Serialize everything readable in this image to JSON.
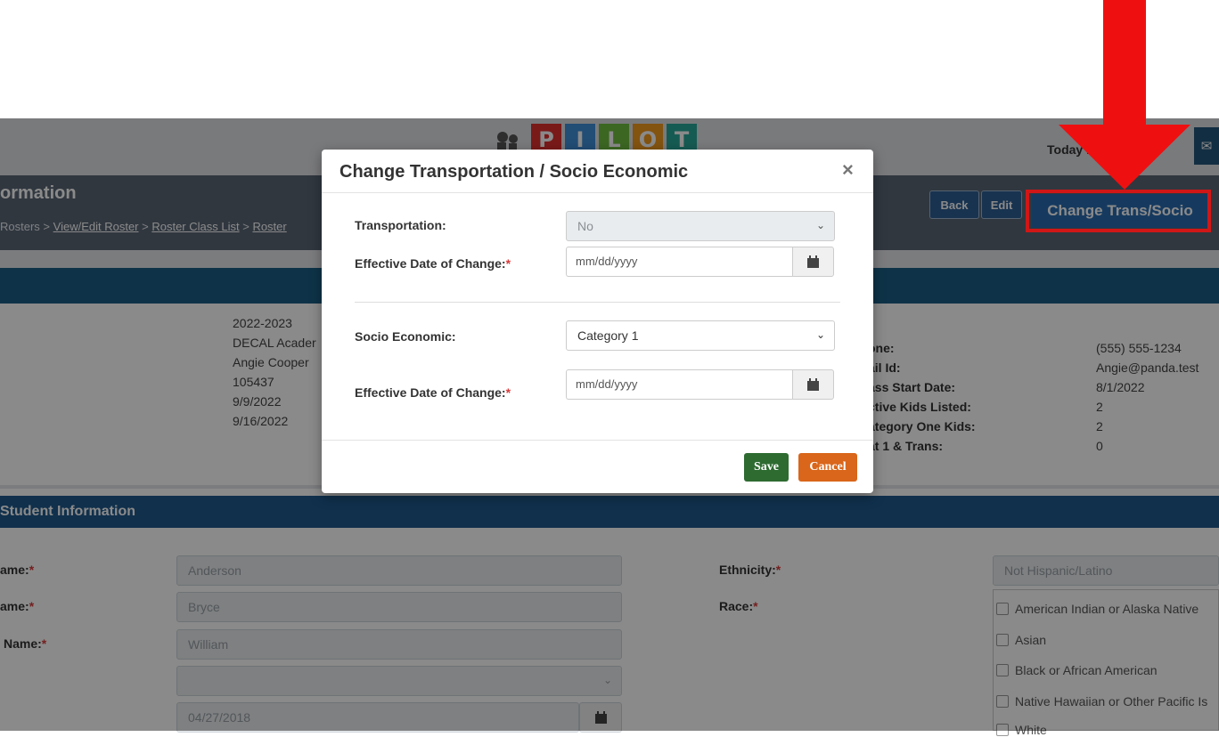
{
  "header": {
    "logo_letters": [
      "P",
      "I",
      "L",
      "O",
      "T"
    ],
    "logo_colors": [
      "#e0312f",
      "#3f8fd8",
      "#6fbf3f",
      "#f39a1e",
      "#2aa89a"
    ],
    "today_text": "Today is 9/9/2022"
  },
  "page": {
    "title": "ormation",
    "breadcrumb": [
      "Rosters",
      "View/Edit Roster",
      "Roster Class List",
      "Roster"
    ],
    "breadcrumb_sep": ">",
    "buttons": {
      "back": "Back",
      "edit": "Edit",
      "change": "Change Trans/Socio"
    }
  },
  "roster_info": {
    "left_values": [
      "2022-2023",
      "DECAL Acader",
      "Angie Cooper",
      "105437",
      "9/9/2022",
      "9/16/2022"
    ],
    "right_labels": [
      "one:",
      "ail Id:",
      "ass Start Date:",
      "ctive Kids Listed:",
      "ategory One Kids:",
      "at 1 & Trans:"
    ],
    "right_values": [
      "(555) 555-1234",
      "Angie@panda.test",
      "8/1/2022",
      "2",
      "2",
      "0"
    ]
  },
  "student": {
    "section_title": "Student Information",
    "fields": [
      {
        "label": "ame:",
        "value": "Anderson"
      },
      {
        "label": "ame:",
        "value": "Bryce"
      },
      {
        "label": "Name:",
        "value": "William"
      },
      {
        "label": "",
        "value": ""
      },
      {
        "label": "",
        "value": "04/27/2018"
      }
    ],
    "ethnicity_label": "Ethnicity:",
    "ethnicity_value": "Not Hispanic/Latino",
    "race_label": "Race:",
    "race_options": [
      "American Indian or Alaska Native",
      "Asian",
      "Black or African American",
      "Native Hawaiian or Other Pacific Is",
      "White"
    ],
    "required_mark": "*"
  },
  "modal": {
    "title": "Change Transportation / Socio Economic",
    "close": "×",
    "transportation_label": "Transportation:",
    "transportation_value": "No",
    "effective_date_label": "Effective Date of Change:",
    "date_placeholder": "mm/dd/yyyy",
    "socio_label": "Socio Economic:",
    "socio_value": "Category 1",
    "required_mark": "*",
    "save": "Save",
    "cancel": "Cancel"
  },
  "colors": {
    "accent_blue": "#2a6bb0",
    "highlight_red": "#d01717",
    "save_green": "#2e6b31",
    "cancel_orange": "#d9661a"
  },
  "icons": {
    "calendar": "calendar-icon",
    "chevron": "chevron-down-icon",
    "close": "close-icon",
    "mail": "mail-icon",
    "arrow": "red-arrow-icon"
  }
}
